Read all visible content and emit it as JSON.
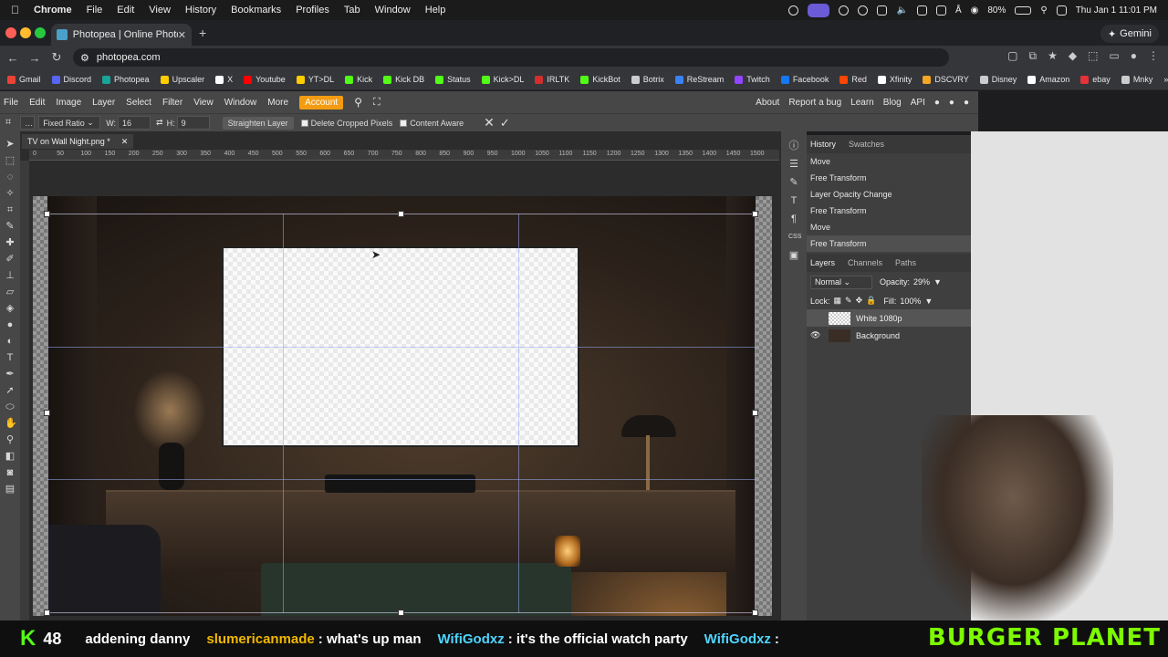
{
  "os_menu": {
    "app": "Chrome",
    "items": [
      "File",
      "Edit",
      "View",
      "History",
      "Bookmarks",
      "Profiles",
      "Tab",
      "Window",
      "Help"
    ],
    "battery": "80%",
    "clock": "Thu Jan 1  11:01 PM"
  },
  "browser": {
    "tab_title": "Photopea | Online Photo Edit",
    "url": "photopea.com",
    "gemini_label": "Gemini",
    "bookmarks": [
      {
        "label": "Gmail",
        "color": "#ea4335"
      },
      {
        "label": "Discord",
        "color": "#5865f2"
      },
      {
        "label": "Photopea",
        "color": "#18a497"
      },
      {
        "label": "Upscaler",
        "color": "#ffcc00"
      },
      {
        "label": "X",
        "color": "#ffffff"
      },
      {
        "label": "Youtube",
        "color": "#ff0000"
      },
      {
        "label": "YT>DL",
        "color": "#ffcc00"
      },
      {
        "label": "Kick",
        "color": "#53fc18"
      },
      {
        "label": "Kick DB",
        "color": "#53fc18"
      },
      {
        "label": "Status",
        "color": "#53fc18"
      },
      {
        "label": "Kick>DL",
        "color": "#53fc18"
      },
      {
        "label": "IRLTK",
        "color": "#d32f2f"
      },
      {
        "label": "KickBot",
        "color": "#53fc18"
      },
      {
        "label": "Botrix",
        "color": "#cccccc"
      },
      {
        "label": "ReStream",
        "color": "#3b82f6"
      },
      {
        "label": "Twitch",
        "color": "#9146ff"
      },
      {
        "label": "Facebook",
        "color": "#1877f2"
      },
      {
        "label": "Red",
        "color": "#ff4500"
      },
      {
        "label": "Xfinity",
        "color": "#ffffff"
      },
      {
        "label": "DSCVRY",
        "color": "#f5a623"
      },
      {
        "label": "Disney",
        "color": "#cccccc"
      },
      {
        "label": "Amazon",
        "color": "#ffffff"
      },
      {
        "label": "ebay",
        "color": "#e53238"
      },
      {
        "label": "Mnky",
        "color": "#cccccc"
      }
    ]
  },
  "photopea": {
    "menu": [
      "File",
      "Edit",
      "Image",
      "Layer",
      "Select",
      "Filter",
      "View",
      "Window",
      "More"
    ],
    "account_label": "Account",
    "links": [
      "About",
      "Report a bug",
      "Learn",
      "Blog",
      "API"
    ],
    "options": {
      "ratio_mode": "Fixed Ratio",
      "w_label": "W:",
      "w_value": "16",
      "h_label": "H:",
      "h_value": "9",
      "straighten_label": "Straighten Layer",
      "delete_cropped_label": "Delete Cropped Pixels",
      "content_aware_label": "Content Aware"
    },
    "document_tab": "TV on Wall Night.png *",
    "ruler_labels": [
      "0",
      "50",
      "100",
      "150",
      "200",
      "250",
      "300",
      "350",
      "400",
      "450",
      "500",
      "550",
      "600",
      "650",
      "700",
      "750",
      "800",
      "850",
      "900",
      "950",
      "1000",
      "1050",
      "1100",
      "1150",
      "1200",
      "1250",
      "1300",
      "1350",
      "1400",
      "1450",
      "1500"
    ],
    "history": {
      "tabs": [
        "History",
        "Swatches"
      ],
      "items": [
        "Move",
        "Free Transform",
        "Layer Opacity Change",
        "Free Transform",
        "Move",
        "Free Transform"
      ]
    },
    "layers": {
      "tabs": [
        "Layers",
        "Channels",
        "Paths"
      ],
      "blend_mode": "Normal",
      "opacity_label": "Opacity:",
      "opacity_value": "29%",
      "lock_label": "Lock:",
      "fill_label": "Fill:",
      "fill_value": "100%",
      "items": [
        {
          "name": "White 1080p"
        },
        {
          "name": "Background"
        }
      ]
    }
  },
  "stream": {
    "viewers": "48",
    "chat": [
      {
        "user": "",
        "text": "addening danny"
      },
      {
        "user": "slumericanmade",
        "text": ": what's up man"
      },
      {
        "user": "WifiGodxz",
        "text": ": it's the official watch party"
      },
      {
        "user": "WifiGodxz",
        "text": ":"
      }
    ],
    "brand": "BURGER PLANET"
  }
}
